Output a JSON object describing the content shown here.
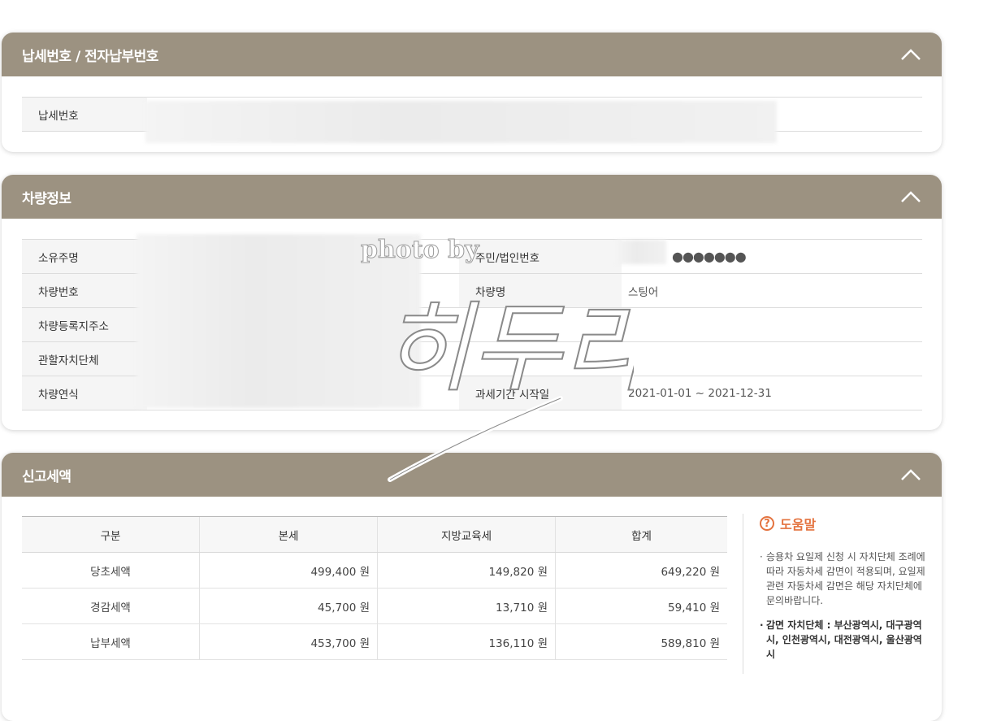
{
  "sections": {
    "payment": {
      "title": "납세번호 / 전자납부번호",
      "tax_no_label": "납세번호"
    },
    "vehicle": {
      "title": "차량정보",
      "owner_label": "소유주명",
      "id_label": "주민/법인번호",
      "id_value": "●●●●●●●",
      "car_no_label": "차량번호",
      "car_name_label": "차량명",
      "car_name_value": "스팅어",
      "address_label": "차량등록지주소",
      "local_gov_label": "관할자치단체",
      "model_year_label": "차량연식",
      "period_label": "과세기간 시작일",
      "period_value": "2021-01-01 ~ 2021-12-31"
    },
    "tax": {
      "title": "신고세액",
      "headers": [
        "구분",
        "본세",
        "지방교육세",
        "합계"
      ],
      "rows": [
        {
          "label": "당초세액",
          "main": "499,400 원",
          "edu": "149,820 원",
          "total": "649,220 원"
        },
        {
          "label": "경감세액",
          "main": "45,700 원",
          "edu": "13,710 원",
          "total": "59,410 원"
        },
        {
          "label": "납부세액",
          "main": "453,700 원",
          "edu": "136,110 원",
          "total": "589,810 원"
        }
      ]
    }
  },
  "help": {
    "title": "도움말",
    "icon": "question-circle-icon",
    "note1": "승용차 요일제 신청 시 자치단체 조례에 따라 자동차세 감면이 적용되며, 요일제 관련 자동차세 감면은 해당 자치단체에 문의바랍니다.",
    "note2": "감면 자치단체 : 부산광역시, 대구광역시, 인천광역시, 대전광역시, 울산광역시"
  },
  "watermark": {
    "line1": "photo by",
    "line2": "히두리"
  },
  "colors": {
    "header_bg": "#9c9281",
    "help_accent": "#e4733f"
  }
}
